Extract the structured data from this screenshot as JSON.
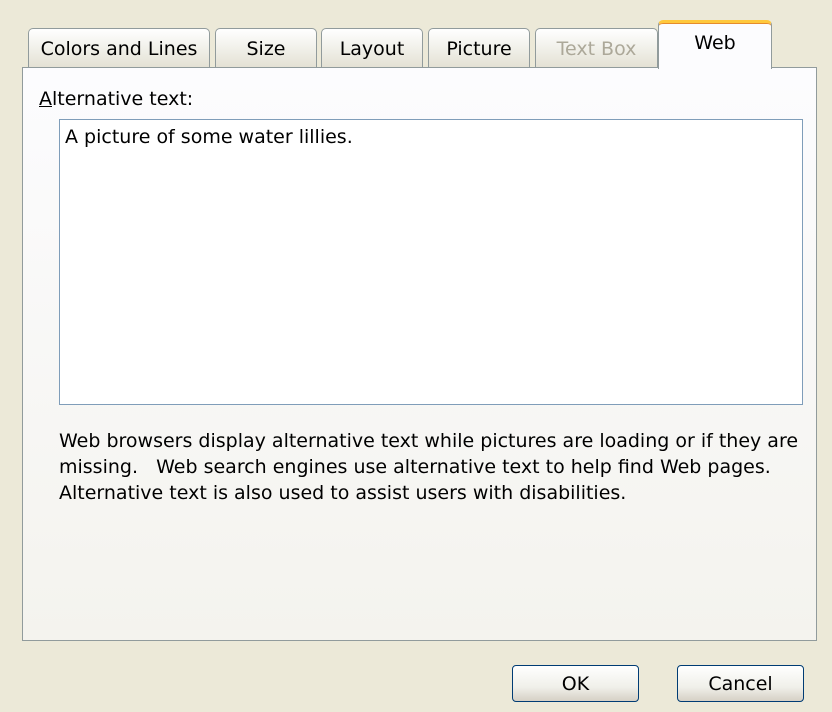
{
  "tabs": [
    {
      "label": "Colors and Lines",
      "state": "normal"
    },
    {
      "label": "Size",
      "state": "normal"
    },
    {
      "label": "Layout",
      "state": "normal"
    },
    {
      "label": "Picture",
      "state": "normal"
    },
    {
      "label": "Text Box",
      "state": "disabled"
    },
    {
      "label": "Web",
      "state": "active"
    }
  ],
  "web": {
    "alt_text_label_mnemonic": "A",
    "alt_text_label_rest": "lternative text:",
    "alt_text_value": "A picture of some water lillies.",
    "description": "Web browsers display alternative text while pictures are loading or if they are missing.   Web search engines use alternative text to help find Web pages.  Alternative text is also used to assist users with disabilities."
  },
  "buttons": {
    "ok": "OK",
    "cancel": "Cancel"
  },
  "colors": {
    "dialog_background": "#ECE9D8",
    "active_tab_highlight": "#FFC83C",
    "disabled_text": "#ACA899"
  }
}
